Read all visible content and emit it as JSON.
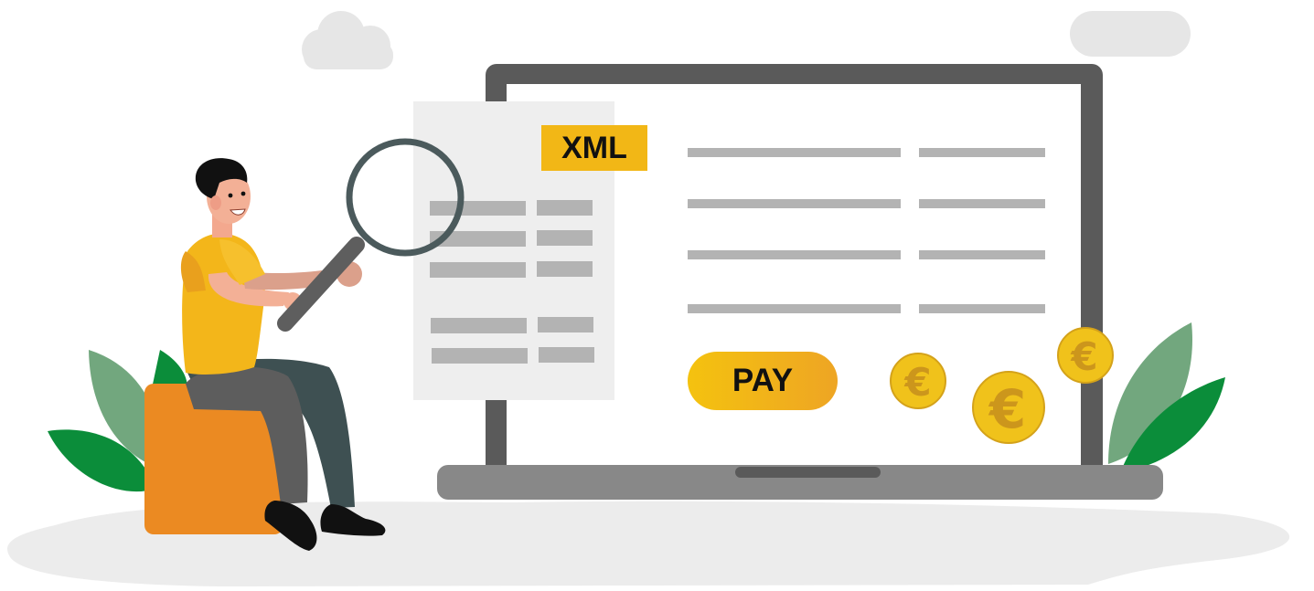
{
  "document": {
    "format_label": "XML"
  },
  "screen": {
    "pay_label": "PAY"
  },
  "coins": {
    "symbol": "€",
    "count": 3
  },
  "colors": {
    "accent_yellow": "#f2b716",
    "pay_gradient_start": "#f4c20f",
    "pay_gradient_end": "#eea524",
    "laptop_frame": "#5a5a5a",
    "laptop_base": "#888888",
    "document_paper": "#eeeeee",
    "placeholder_line": "#b3b3b3",
    "leaf_dark": "#0b8d3a",
    "leaf_light": "#72a77e",
    "stool": "#eb8a22",
    "ground": "#ececec",
    "cloud": "#e6e6e6",
    "magnifier_ring": "#4b5a5c"
  }
}
